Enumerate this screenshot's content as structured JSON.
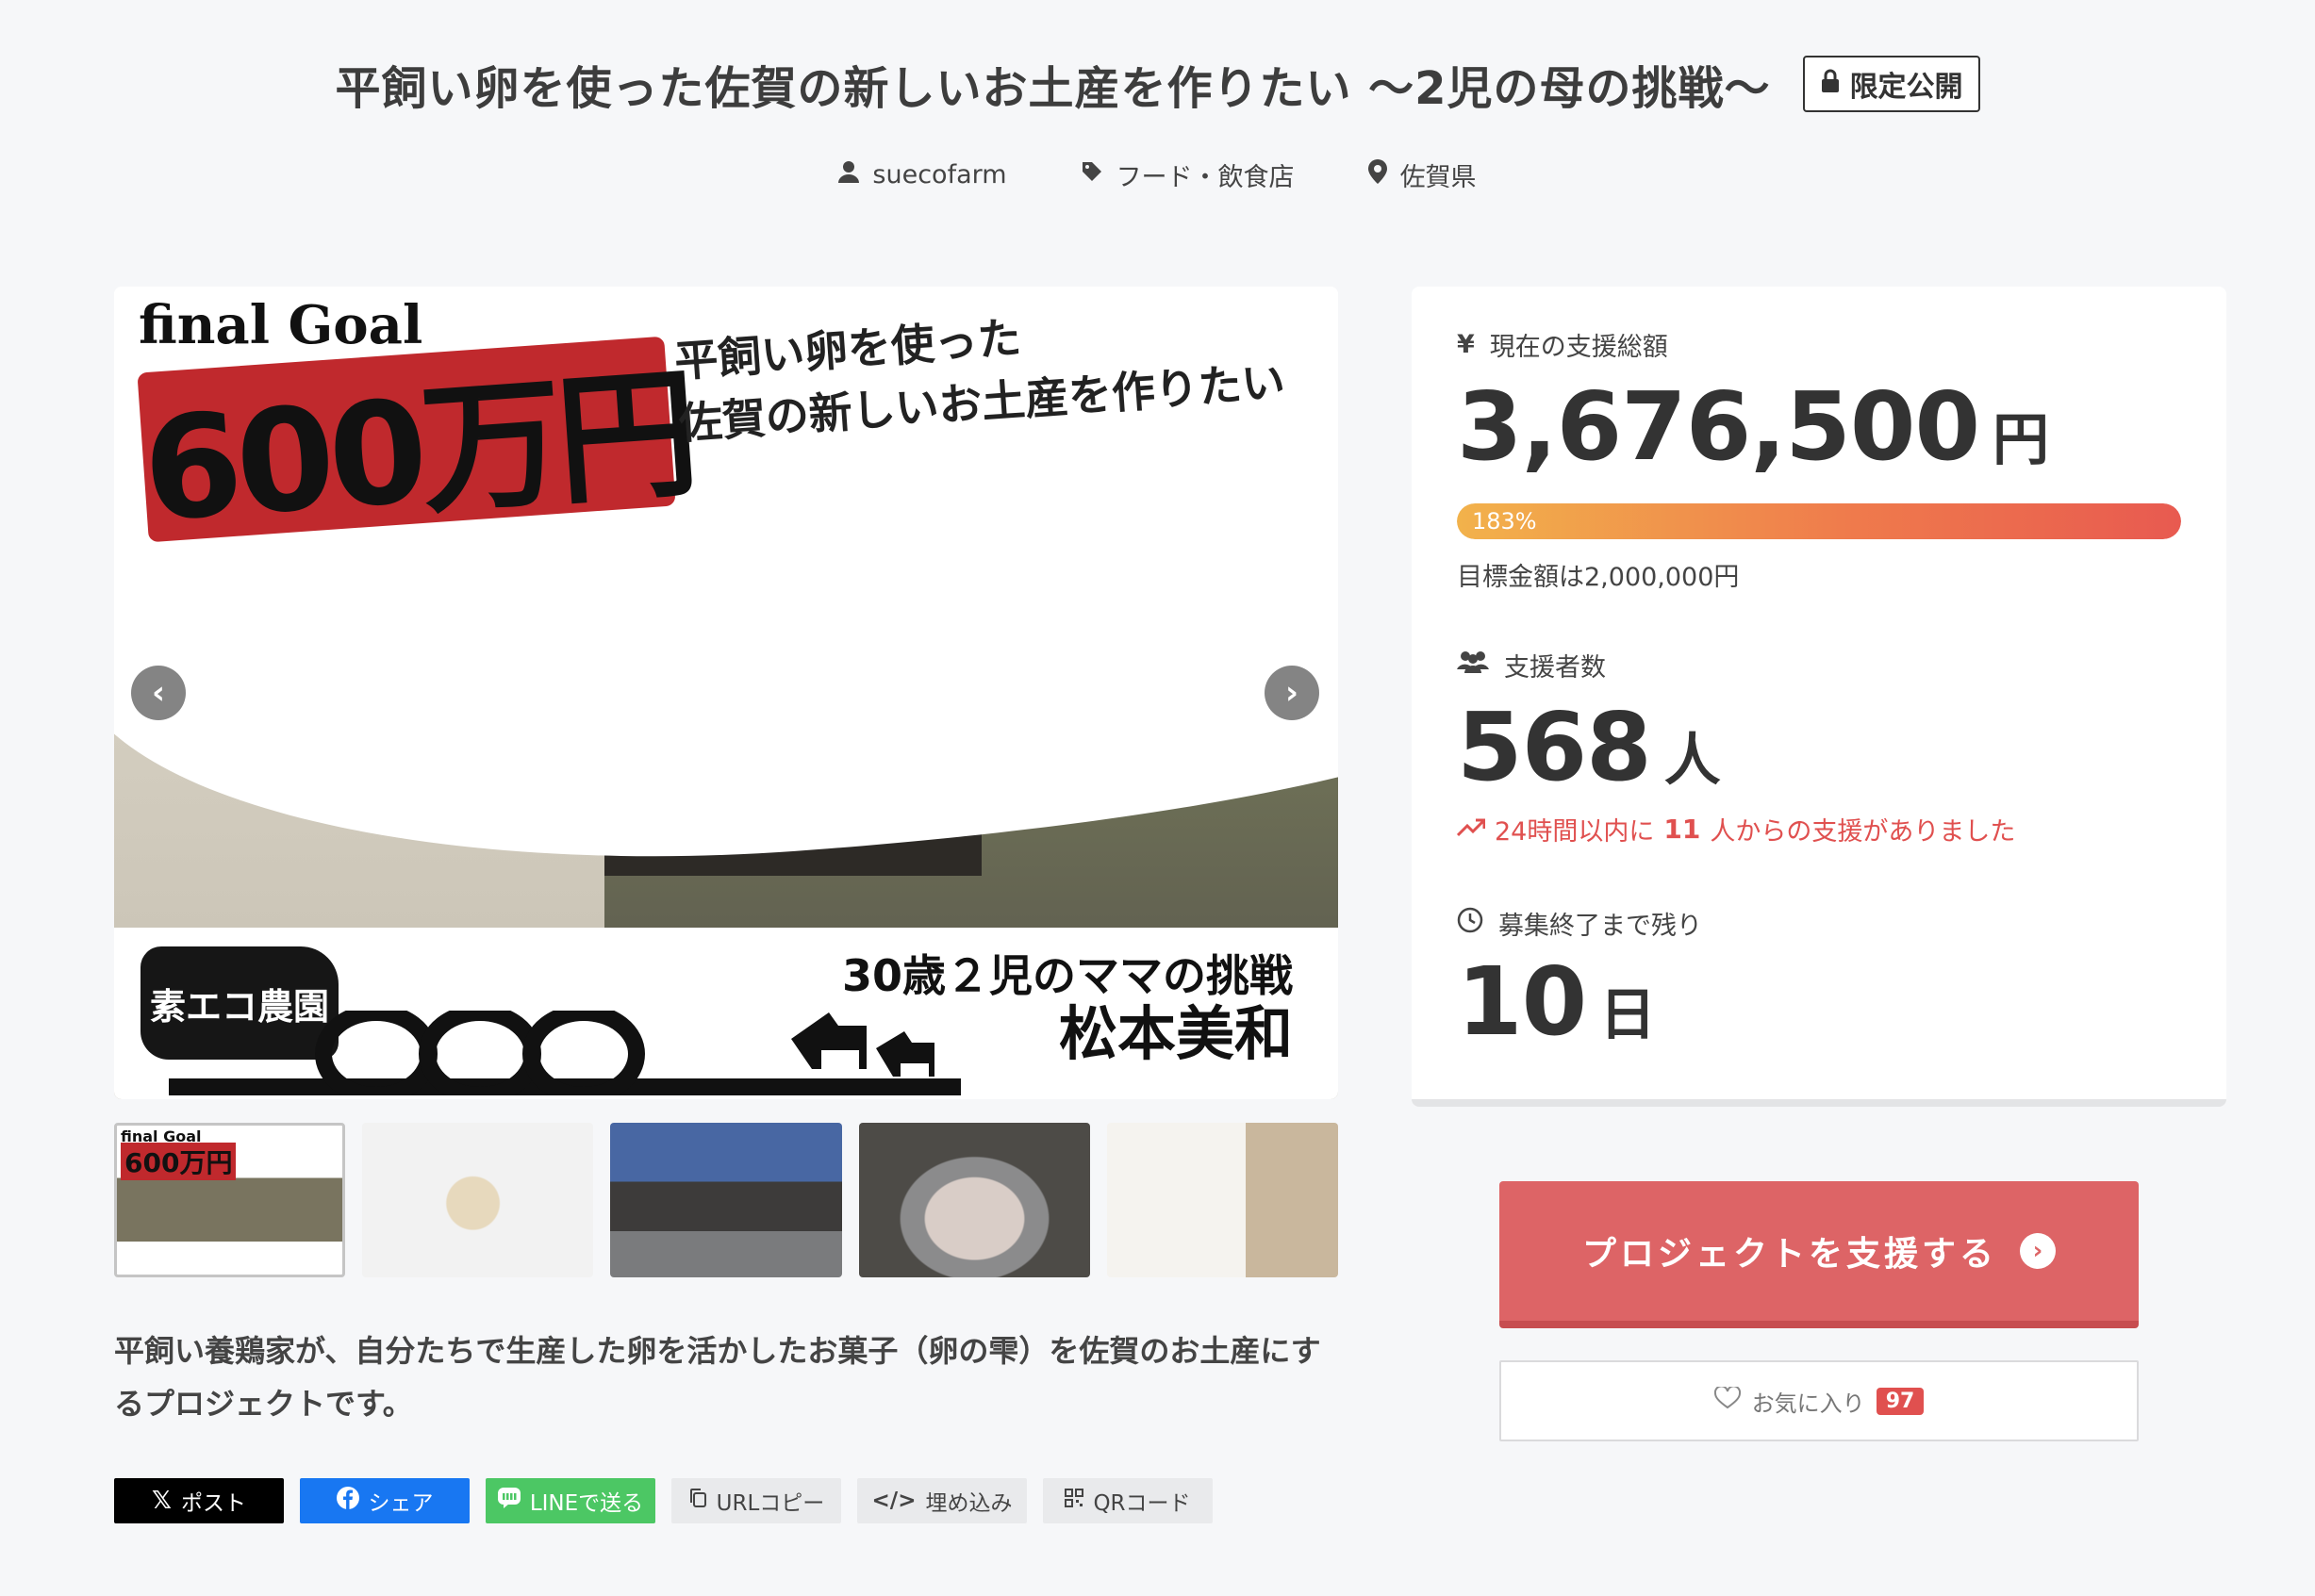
{
  "header": {
    "title": "平飼い卵を使った佐賀の新しいお土産を作りたい 〜2児の母の挑戦〜",
    "badge": "限定公開",
    "owner": "suecofarm",
    "category": "フード・飲食店",
    "location": "佐賀県"
  },
  "hero": {
    "final_goal": "final Goal",
    "goal_amount": "600万円",
    "headline_line1": "平飼い卵を使った",
    "headline_line2": "佐賀の新しいお土産を作りたい",
    "farm_name": "素エコ農園",
    "subtitle": "30歳２児のママの挑戦",
    "person_name": "松本美和"
  },
  "thumbnails": {
    "first_label": "final Goal",
    "first_amount": "600万円"
  },
  "description": "平飼い養鶏家が、自分たちで生産した卵を活かしたお菓子（卵の雫）を佐賀のお土産にするプロジェクトです。",
  "share": {
    "x": "ポスト",
    "facebook": "シェア",
    "line": "LINEで送る",
    "url_copy": "URLコピー",
    "embed": "埋め込み",
    "qr": "QRコード"
  },
  "stats": {
    "total_label": "現在の支援総額",
    "total_amount": "3,676,500",
    "total_unit": "円",
    "progress_percent": 183,
    "progress_text": "183%",
    "goal_note": "目標金額は2,000,000円",
    "supporters_label": "支援者数",
    "supporters_count": "568",
    "supporters_unit": "人",
    "trend_prefix": "24時間以内に",
    "trend_count": "11",
    "trend_suffix": "人からの支援がありました",
    "remaining_label": "募集終了まで残り",
    "remaining_count": "10",
    "remaining_unit": "日"
  },
  "actions": {
    "support": "プロジェクトを支援する",
    "favorite": "お気に入り",
    "favorite_count": "97"
  },
  "colors": {
    "accent": "#dd6466",
    "trend": "#e0504f",
    "progress_start": "#f2b24b",
    "progress_end": "#e85a50"
  }
}
